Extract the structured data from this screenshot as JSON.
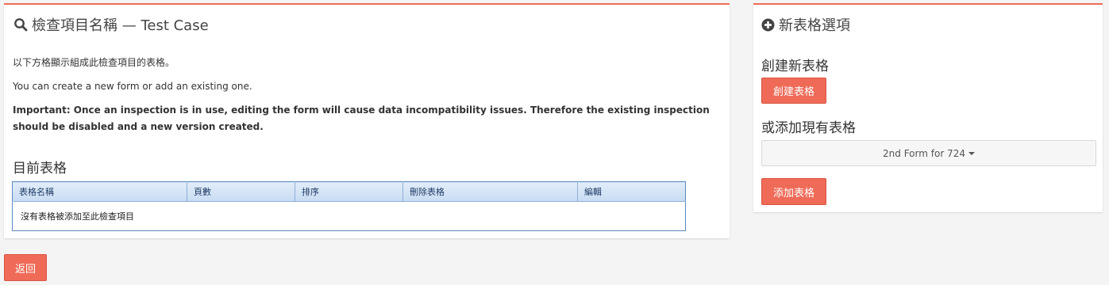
{
  "left_panel": {
    "title": "檢查項目名稱 — Test Case",
    "intro_1": "以下方格顯示組成此檢查項目的表格。",
    "intro_2": "You can create a new form or add an existing one.",
    "important": "Important: Once an inspection is in use, editing the form will cause data incompatibility issues. Therefore the existing inspection should be disabled and a new version created.",
    "current_forms_heading": "目前表格",
    "table": {
      "headers": [
        "表格名稱",
        "頁數",
        "排序",
        "刪除表格",
        "編輯"
      ],
      "empty_message": "沒有表格被添加至此檢查項目"
    }
  },
  "right_panel": {
    "title": "新表格選項",
    "create_heading": "創建新表格",
    "create_button": "創建表格",
    "add_existing_heading": "或添加現有表格",
    "selected_form": "2nd Form for 724",
    "add_button": "添加表格"
  },
  "back_button": "返回",
  "colors": {
    "accent": "#ef6b58",
    "table_header": "#c7dbf2",
    "table_border": "#5b89c0"
  },
  "icons": {
    "left_title": "search-icon",
    "right_title": "plus-circle-icon",
    "dropdown": "caret-down-icon"
  }
}
